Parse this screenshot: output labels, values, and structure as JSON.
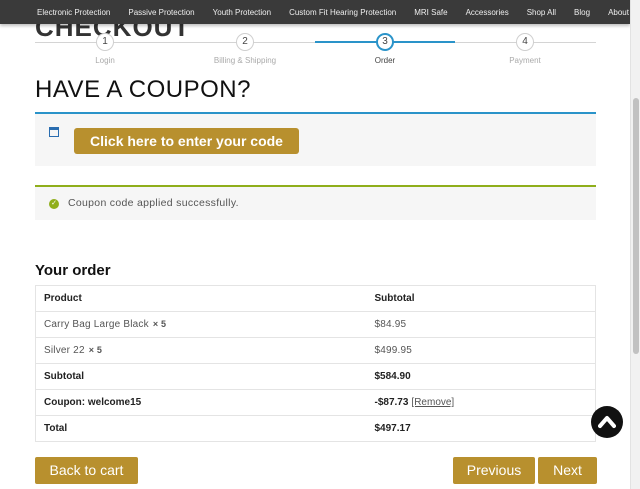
{
  "nav": {
    "items": [
      "Electronic Protection",
      "Passive Protection",
      "Youth Protection",
      "Custom Fit Hearing Protection",
      "MRI Safe",
      "Accessories",
      "Shop All",
      "Blog",
      "About"
    ]
  },
  "page_title_partial": "CHECKOUT",
  "steps": [
    {
      "number": "1",
      "label": "Login"
    },
    {
      "number": "2",
      "label": "Billing & Shipping"
    },
    {
      "number": "3",
      "label": "Order"
    },
    {
      "number": "4",
      "label": "Payment"
    }
  ],
  "coupon": {
    "heading": "HAVE A COUPON?",
    "button_label": "Click here to enter your code"
  },
  "notice": {
    "message": "Coupon code applied successfully."
  },
  "order": {
    "heading": "Your order",
    "headers": {
      "product": "Product",
      "subtotal": "Subtotal"
    },
    "items": [
      {
        "name": "Carry Bag Large Black",
        "qty": "× 5",
        "subtotal": "$84.95"
      },
      {
        "name": "Silver 22",
        "qty": "× 5",
        "subtotal": "$499.95"
      }
    ],
    "subtotal": {
      "label": "Subtotal",
      "value": "$584.90"
    },
    "coupon_line": {
      "label": "Coupon: welcome15",
      "value": "-$87.73",
      "remove": "[Remove]"
    },
    "total": {
      "label": "Total",
      "value": "$497.17"
    }
  },
  "buttons": {
    "back": "Back to cart",
    "previous": "Previous",
    "next": "Next"
  },
  "colors": {
    "accent_gold": "#b8902e",
    "step_blue": "#2a93c9",
    "success_green": "#8fae1b",
    "nav_bg": "#3a3a3a"
  },
  "icons": {
    "scroll_top": "chevron-up-icon",
    "notice": "check-circle-icon",
    "coupon": "window-icon"
  }
}
